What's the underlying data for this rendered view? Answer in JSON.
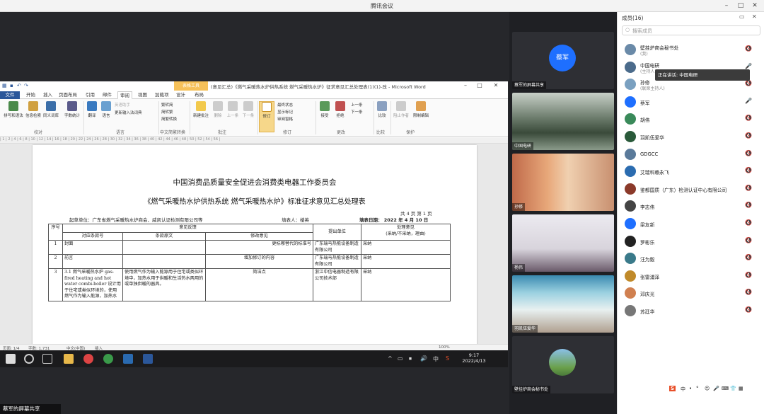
{
  "window": {
    "title": "腾讯会议",
    "min": "–",
    "max": "□",
    "close": "✕"
  },
  "word": {
    "doc_title": "(意见汇总)《燃气采暖热水炉供热系统 燃气采暖热水炉》征求意见汇总处理表(1)(1)-改 - Microsoft Word",
    "context_tab": "表格工具",
    "tabs": [
      "文件",
      "开始",
      "插入",
      "页面布局",
      "引用",
      "邮件",
      "审阅",
      "视图",
      "加载项",
      "设计",
      "布局"
    ],
    "ribbon": {
      "buttons": [
        "拼写和语法",
        "信息检索",
        "同义词库",
        "字数统计",
        "翻译",
        "语言",
        "新建批注",
        "删除",
        "上一条",
        "下一条",
        "修订",
        "接受",
        "拒绝",
        "比较",
        "阻止作者",
        "限制编辑"
      ],
      "small": [
        "英语助手",
        "更新输入法词典",
        "繁转简",
        "简转繁",
        "简繁转换",
        "显示标记",
        "审阅窗格",
        "最终状态",
        "上一条",
        "下一条"
      ],
      "groups": [
        "校对",
        "语言",
        "中文简繁转换",
        "批注",
        "修订",
        "更改",
        "比较",
        "保护"
      ]
    },
    "ruler": "| 1 | 2 | 4 | 6 | 8 | 10 | 12 | 14 | 16 | 18 | 20 | 22 | 24 | 26 | 28 | 30 | 32 | 34 | 36 | 38 | 40 | 42 | 44 | 46 | 48 | 50 | 52 | 54 | 56 |",
    "heading1": "中国消费品质量安全促进会消费类电器工作委员会",
    "heading2": "《燃气采暖热水炉供热系统 燃气采暖热水炉》标准征求意见汇总处理表",
    "page_info": "共 4 页    第 1 页",
    "org": "起草单位：广东省燃气采暖热水炉商会、威凯认证检测有限公司等",
    "filler": "填表人：楼英",
    "date": "填表日期： 2022 年 4 月 10 日",
    "table": {
      "h_no": "序号",
      "h_opinion": "意见反馈",
      "h_clause_no": "对应条款号",
      "h_clause_text": "条款原文",
      "h_modify": "修改意见",
      "h_unit": "提出单位",
      "h_handle": "处理意见",
      "h_handle_sub": "(采纳/不采纳，理由)",
      "rows": [
        {
          "no": "1",
          "clause": "封面",
          "text": "",
          "modify": "更标哪替代的标准号",
          "unit": "广东瑞马热能设备制造有限公司",
          "handle": "采纳"
        },
        {
          "no": "2",
          "clause": "前言",
          "text": "",
          "modify": "增加修订的内容",
          "unit": "广东瑞马热能设备制造有限公司",
          "handle": "采纳"
        },
        {
          "no": "3",
          "clause": "3.1 燃气采暖热水炉 gas-fired heating and hot water combi-boiler 设计用于住宅或类似环境的，使用燃气作为输入能源，加热水",
          "text": "使用燃气作为输入能源用于住宅或类似环境中，加热水用于供暖和生活热水两用的或单独供暖的器具。",
          "modify": "简洁点",
          "unit": "浙江中信电器制造有限公司技术部",
          "handle": "采纳"
        }
      ]
    },
    "status": {
      "page": "页面: 1/4",
      "words": "字数: 1,731",
      "lang": "中文(中国)",
      "mode": "插入",
      "zoom": "100%"
    },
    "ime": [
      "S",
      "中",
      "•",
      "°",
      "☺",
      "🎤",
      "⌨",
      "👕",
      "▦"
    ]
  },
  "taskbar": {
    "time": "9:17",
    "date": "2022/4/13",
    "tray": [
      "^",
      "▭",
      "⏹",
      "🔊",
      "中",
      "S"
    ]
  },
  "share_label": "蔡军的屏幕共享",
  "videos": [
    {
      "name": "蔡军的屏幕共享",
      "avatar": "蔡军"
    },
    {
      "name": "中国电研",
      "avatar": ""
    },
    {
      "name": "孙修",
      "avatar": ""
    },
    {
      "name": "杨伟",
      "avatar": ""
    },
    {
      "name": "羽凯伍爱华",
      "avatar": ""
    },
    {
      "name": "壁挂炉商会秘书处",
      "avatar": ""
    }
  ],
  "panel": {
    "title": "成员(16)",
    "search": "搜索成员",
    "tooltip": "正在讲话: 中国电研",
    "members": [
      {
        "name": "壁挂炉商会秘书处",
        "role": "(我)",
        "color": "#6a8aa8",
        "mic": "🔇"
      },
      {
        "name": "中国电研",
        "role": "(主持人)",
        "color": "#4b6b8b",
        "mic": "🎤"
      },
      {
        "name": "孙修",
        "role": "(联席主持人)",
        "color": "#7aa0c0",
        "mic": "🔇"
      },
      {
        "name": "蔡军",
        "role": "",
        "color": "#1e6fff",
        "mic": "🎤"
      },
      {
        "name": "胡伟",
        "role": "",
        "color": "#3a8a5a",
        "mic": "🔇"
      },
      {
        "name": "羽凯伍爱华",
        "role": "",
        "color": "#2a5a3a",
        "mic": "🔇"
      },
      {
        "name": "GDGCC",
        "role": "",
        "color": "#5a7a9a",
        "mic": "🔇"
      },
      {
        "name": "艾瑞科赖永飞",
        "role": "",
        "color": "#2b6cb0",
        "mic": "🔇"
      },
      {
        "name": "鉴都国质（广东）检测认证中心有限公司",
        "role": "",
        "color": "#8b3a2a",
        "mic": "🔇"
      },
      {
        "name": "李志伟",
        "role": "",
        "color": "#444444",
        "mic": "🔇"
      },
      {
        "name": "梁友新",
        "role": "",
        "color": "#1e6fff",
        "mic": "🔇"
      },
      {
        "name": "罗彬乐",
        "role": "",
        "color": "#222222",
        "mic": "🔇"
      },
      {
        "name": "汪为毅",
        "role": "",
        "color": "#3a7a8a",
        "mic": "🔇"
      },
      {
        "name": "张雷浦泽",
        "role": "",
        "color": "#c08a2a",
        "mic": "🔇"
      },
      {
        "name": "邓庆光",
        "role": "",
        "color": "#d08050",
        "mic": "🔇"
      },
      {
        "name": "苏廷华",
        "role": "",
        "color": "#777777",
        "mic": "🔇"
      }
    ]
  },
  "colors": {
    "accent": "#1e6fff",
    "word_blue": "#2b579a",
    "mic_muted": "#e0403a",
    "mic_on": "#999999"
  }
}
